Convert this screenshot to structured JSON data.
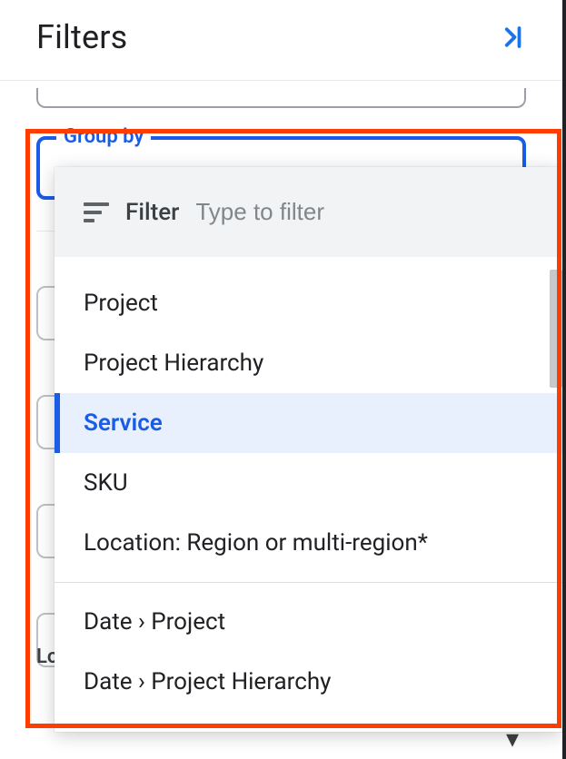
{
  "header": {
    "title": "Filters",
    "collapse_icon": "❯|"
  },
  "group_by": {
    "legend": "Group by"
  },
  "dropdown": {
    "filter_label": "Filter",
    "filter_placeholder": "Type to filter",
    "options_group1": [
      "Project",
      "Project Hierarchy",
      "Service",
      "SKU",
      "Location: Region or multi-region*"
    ],
    "options_group2": [
      "Date › Project",
      "Date › Project Hierarchy"
    ],
    "selected": "Service"
  },
  "below_section": {
    "label": "Locations"
  }
}
